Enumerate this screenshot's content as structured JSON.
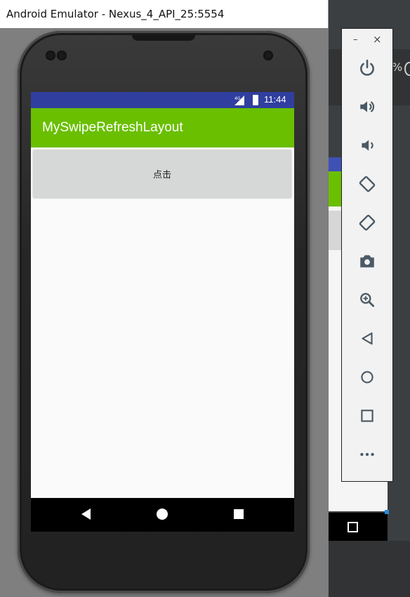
{
  "window": {
    "title": "Android Emulator - Nexus_4_API_25:5554"
  },
  "status_bar": {
    "network": "4G",
    "time": "11:44"
  },
  "app": {
    "title": "MySwipeRefreshLayout",
    "button_label": "点击"
  },
  "toolbar": {
    "minimize": "–",
    "close": "×",
    "items": [
      {
        "icon": "power-icon"
      },
      {
        "icon": "volume-up-icon"
      },
      {
        "icon": "volume-down-icon"
      },
      {
        "icon": "rotate-left-icon"
      },
      {
        "icon": "rotate-right-icon"
      },
      {
        "icon": "camera-icon"
      },
      {
        "icon": "zoom-icon"
      },
      {
        "icon": "back-icon"
      },
      {
        "icon": "home-icon"
      },
      {
        "icon": "overview-icon"
      },
      {
        "icon": "more-icon"
      }
    ]
  },
  "background_ide": {
    "percent_text": "%"
  },
  "colors": {
    "status_bar": "#303f9f",
    "app_bar": "#6abf00",
    "button": "#d6d7d7",
    "toolbar_icon": "#4a5a66"
  }
}
